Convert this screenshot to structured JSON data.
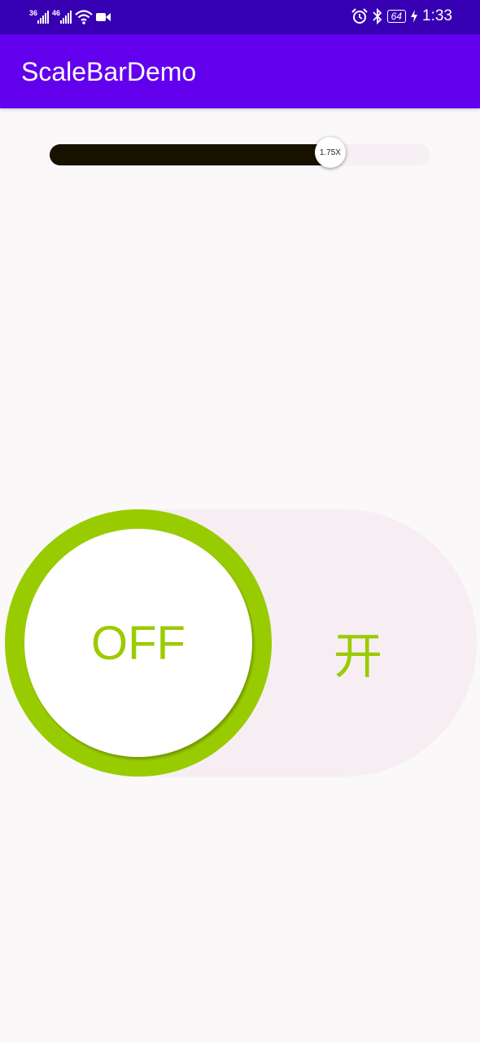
{
  "status_bar": {
    "signal_1_tag": "36",
    "signal_2_tag": "46",
    "battery": "64",
    "time": "1:33"
  },
  "app_bar": {
    "title": "ScaleBarDemo"
  },
  "scale_bar": {
    "value_label": "1.75X",
    "fill_fraction": 0.737
  },
  "toggle_switch": {
    "state": "off",
    "knob_label": "OFF",
    "track_label": "开",
    "accent_color": "#99cc00"
  },
  "colors": {
    "status_bar": "#3700b3",
    "app_bar": "#6200ee",
    "background": "#faf8f8",
    "slider_fill": "#171100",
    "slider_track": "#f6eff3"
  }
}
